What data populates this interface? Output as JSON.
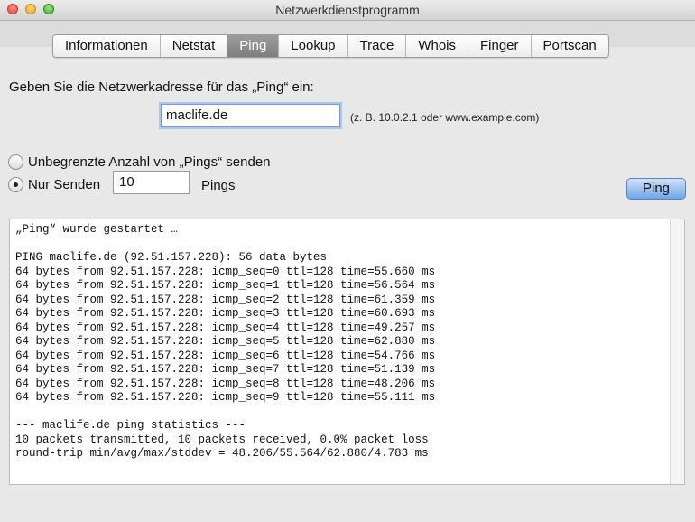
{
  "window": {
    "title": "Netzwerkdienstprogramm"
  },
  "tabs": [
    {
      "label": "Informationen",
      "active": false
    },
    {
      "label": "Netstat",
      "active": false
    },
    {
      "label": "Ping",
      "active": true
    },
    {
      "label": "Lookup",
      "active": false
    },
    {
      "label": "Trace",
      "active": false
    },
    {
      "label": "Whois",
      "active": false
    },
    {
      "label": "Finger",
      "active": false
    },
    {
      "label": "Portscan",
      "active": false
    }
  ],
  "form": {
    "prompt": "Geben Sie die Netzwerkadresse für das „Ping“ ein:",
    "address_value": "maclife.de",
    "address_hint": "(z. B. 10.0.2.1 oder www.example.com)",
    "radio_unlimited_label": "Unbegrenzte Anzahl von „Pings“ senden",
    "radio_limited_label": "Nur Senden",
    "selected_radio": "limited",
    "count_value": "10",
    "count_suffix": "Pings",
    "ping_button": "Ping"
  },
  "output": {
    "lines": [
      "„Ping“ wurde gestartet …",
      "",
      "PING maclife.de (92.51.157.228): 56 data bytes",
      "64 bytes from 92.51.157.228: icmp_seq=0 ttl=128 time=55.660 ms",
      "64 bytes from 92.51.157.228: icmp_seq=1 ttl=128 time=56.564 ms",
      "64 bytes from 92.51.157.228: icmp_seq=2 ttl=128 time=61.359 ms",
      "64 bytes from 92.51.157.228: icmp_seq=3 ttl=128 time=60.693 ms",
      "64 bytes from 92.51.157.228: icmp_seq=4 ttl=128 time=49.257 ms",
      "64 bytes from 92.51.157.228: icmp_seq=5 ttl=128 time=62.880 ms",
      "64 bytes from 92.51.157.228: icmp_seq=6 ttl=128 time=54.766 ms",
      "64 bytes from 92.51.157.228: icmp_seq=7 ttl=128 time=51.139 ms",
      "64 bytes from 92.51.157.228: icmp_seq=8 ttl=128 time=48.206 ms",
      "64 bytes from 92.51.157.228: icmp_seq=9 ttl=128 time=55.111 ms",
      "",
      "--- maclife.de ping statistics ---",
      "10 packets transmitted, 10 packets received, 0.0% packet loss",
      "round-trip min/avg/max/stddev = 48.206/55.564/62.880/4.783 ms"
    ]
  }
}
